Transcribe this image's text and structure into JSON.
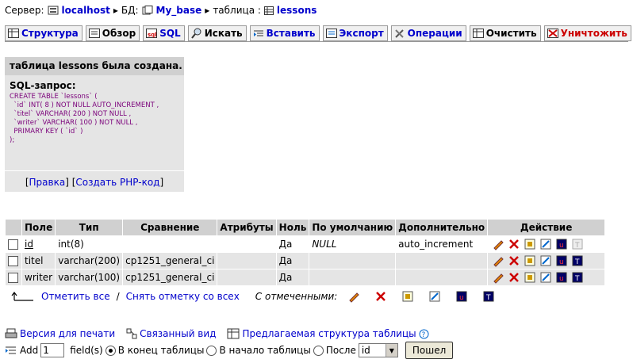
{
  "breadcrumb": {
    "server_label": "Сервер:",
    "server": "localhost",
    "db_label": "БД:",
    "db": "My_base",
    "table_label": "таблица :",
    "table": "lessons"
  },
  "tabs": [
    {
      "label": "Структура"
    },
    {
      "label": "Обзор"
    },
    {
      "label": "SQL"
    },
    {
      "label": "Искать"
    },
    {
      "label": "Вставить"
    },
    {
      "label": "Экспорт"
    },
    {
      "label": "Операции"
    },
    {
      "label": "Очистить"
    },
    {
      "label": "Уничтожить"
    }
  ],
  "message": {
    "title": "таблица lessons была создана.",
    "sql_label": "SQL-запрос:",
    "sql_lines": [
      "CREATE TABLE `lessons` (",
      "  `id` INT( 8 ) NOT NULL AUTO_INCREMENT ,",
      "  `titel` VARCHAR( 200 ) NOT NULL ,",
      "  `writer` VARCHAR( 100 ) NOT NULL ,",
      "  PRIMARY KEY ( `id` )",
      ");"
    ],
    "edit_link": "Правка",
    "php_link": "Создать PHP-код"
  },
  "columns": [
    "Поле",
    "Тип",
    "Сравнение",
    "Атрибуты",
    "Ноль",
    "По умолчанию",
    "Дополнительно",
    "Действие"
  ],
  "rows": [
    {
      "field": "id",
      "type": "int(8)",
      "collation": "",
      "attributes": "",
      "null": "Да",
      "default": "NULL",
      "extra": "auto_increment"
    },
    {
      "field": "titel",
      "type": "varchar(200)",
      "collation": "cp1251_general_ci",
      "attributes": "",
      "null": "Да",
      "default": "",
      "extra": ""
    },
    {
      "field": "writer",
      "type": "varchar(100)",
      "collation": "cp1251_general_ci",
      "attributes": "",
      "null": "Да",
      "default": "",
      "extra": ""
    }
  ],
  "selection": {
    "check_all": "Отметить все",
    "separator": "/",
    "uncheck_all": "Снять отметку со всех",
    "with_selected": "С отмеченными:"
  },
  "footer": {
    "print": "Версия для печати",
    "relation": "Связанный вид",
    "propose": "Предлагаемая структура таблицы",
    "add_label": "Add",
    "add_count": "1",
    "fields_label": "field(s)",
    "at_end": "В конец таблицы",
    "at_start": "В начало таблицы",
    "after": "После",
    "after_field": "id",
    "go": "Пошел"
  },
  "colors": {
    "link": "#0000cc",
    "header_bg": "#d0d0d0",
    "row_alt": "#e5e5e5",
    "danger": "#cc0000"
  }
}
